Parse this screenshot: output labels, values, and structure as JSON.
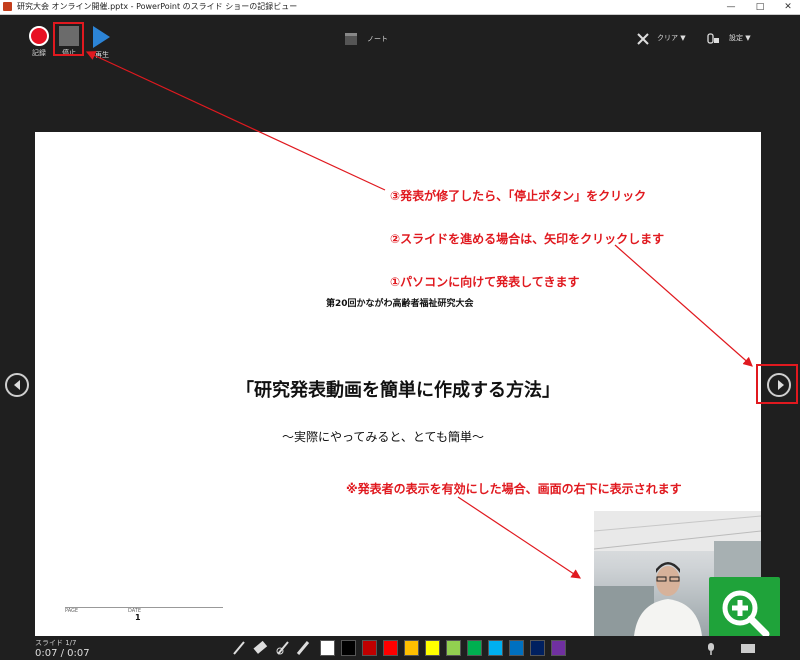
{
  "window": {
    "title": "研究大会 オンライン開催.pptx - PowerPoint のスライド ショーの記録ビュー",
    "minimize_glyph": "—",
    "maximize_glyph": "□",
    "close_glyph": "✕"
  },
  "toolbar": {
    "record_label": "記録",
    "stop_label": "停止",
    "play_label": "再生",
    "notes_label": "ノート",
    "clear_label": "クリア ▼",
    "settings_label": "設定 ▼"
  },
  "annotations": {
    "step3": "③発表が修了したら、「停止ボタン」をクリック",
    "step2": "②スライドを進める場合は、矢印をクリックします",
    "step1": "①パソコンに向けて発表してきます",
    "note": "※発表者の表示を有効にした場合、画面の右下に表示されます"
  },
  "slide": {
    "event": "第20回かながわ高齢者福祉研究大会",
    "title": "「研究発表動画を簡単に作成する方法」",
    "subtitle": "〜実際にやってみると、とても簡単〜",
    "page_label": "PAGE",
    "page_number": "1",
    "date_label": "DATE"
  },
  "status": {
    "slide_counter": "スライド 1/7",
    "timer": "0:07 / 0:07"
  },
  "ink_colors": [
    "#ffffff",
    "#000000",
    "#c00000",
    "#ff0000",
    "#ffc000",
    "#ffff00",
    "#92d050",
    "#00b050",
    "#00b0f0",
    "#0070c0",
    "#002060",
    "#7030a0"
  ],
  "accent": {
    "annotation_red": "#e0191f",
    "record_red": "#e81123",
    "play_blue": "#2c84d6",
    "zoom_green": "#1fa33a"
  },
  "icons": [
    "record-icon",
    "stop-icon",
    "play-icon",
    "notes-icon",
    "clear-x-icon",
    "settings-icon",
    "prev-arrow-icon",
    "next-arrow-icon",
    "pen-icon",
    "eraser-icon",
    "laser-icon",
    "highlighter-icon",
    "zoom-in-icon",
    "mic-icon",
    "camera-icon"
  ]
}
